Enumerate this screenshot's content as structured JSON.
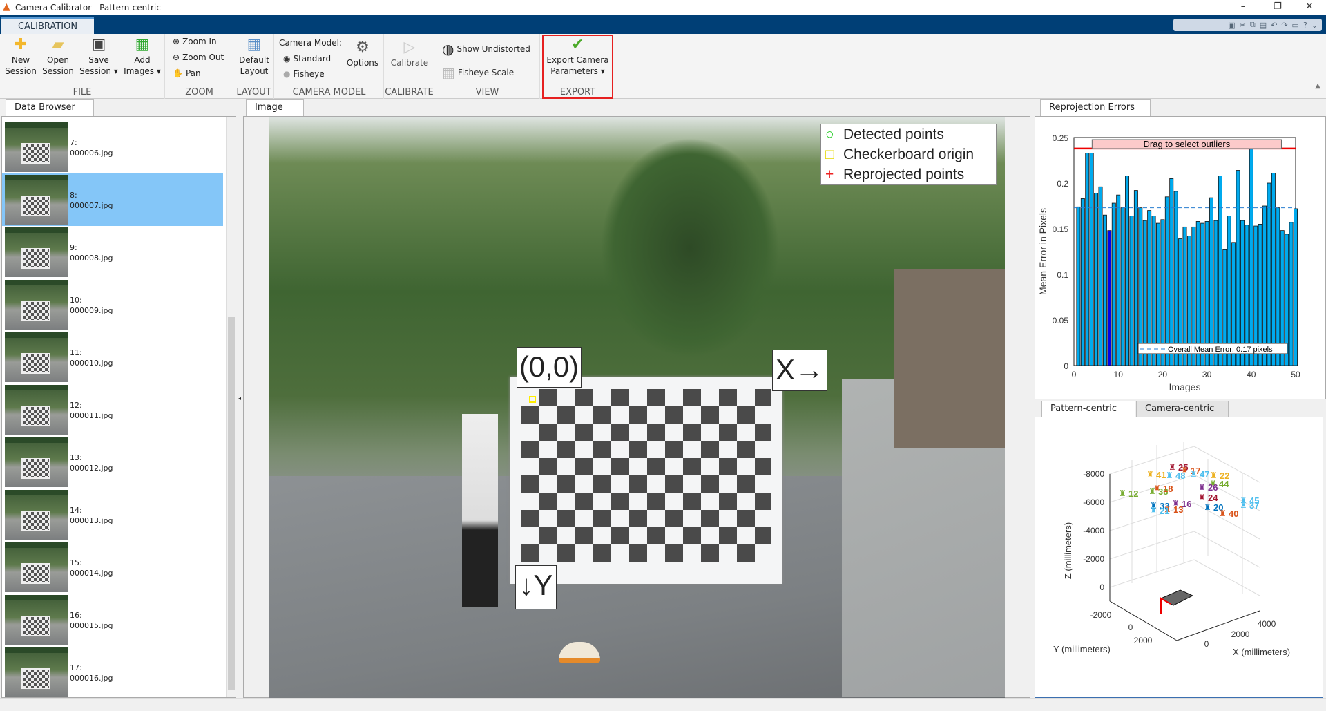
{
  "window": {
    "title": "Camera Calibrator - Pattern-centric",
    "controls": [
      "minimize",
      "restore",
      "close"
    ]
  },
  "ribbon": {
    "tab": "CALIBRATION",
    "groups": {
      "file": {
        "label": "FILE",
        "new_session": "New Session",
        "open_session": "Open Session",
        "save_session": "Save Session",
        "add_images": "Add Images"
      },
      "zoom": {
        "label": "ZOOM",
        "zoom_in": "Zoom In",
        "zoom_out": "Zoom Out",
        "pan": "Pan"
      },
      "layout": {
        "label": "LAYOUT",
        "default_layout": "Default Layout"
      },
      "camera_model": {
        "label": "CAMERA MODEL",
        "title": "Camera Model:",
        "standard": "Standard",
        "fisheye": "Fisheye",
        "selected": "Standard",
        "options": "Options"
      },
      "calibrate": {
        "label": "CALIBRATE",
        "calibrate": "Calibrate"
      },
      "view": {
        "label": "VIEW",
        "show_undistorted": "Show Undistorted",
        "fisheye_scale": "Fisheye Scale"
      },
      "export": {
        "label": "EXPORT",
        "export_camera_parameters": "Export Camera Parameters",
        "highlight_color": "#e62020"
      }
    }
  },
  "data_browser": {
    "tab": "Data Browser",
    "selected_index": 1,
    "items": [
      {
        "num": "7:",
        "file": "000006.jpg"
      },
      {
        "num": "8:",
        "file": "000007.jpg"
      },
      {
        "num": "9:",
        "file": "000008.jpg"
      },
      {
        "num": "10:",
        "file": "000009.jpg"
      },
      {
        "num": "11:",
        "file": "000010.jpg"
      },
      {
        "num": "12:",
        "file": "000011.jpg"
      },
      {
        "num": "13:",
        "file": "000012.jpg"
      },
      {
        "num": "14:",
        "file": "000013.jpg"
      },
      {
        "num": "15:",
        "file": "000014.jpg"
      },
      {
        "num": "16:",
        "file": "000015.jpg"
      },
      {
        "num": "17:",
        "file": "000016.jpg"
      }
    ],
    "selected_color": "#84c6f8"
  },
  "image_panel": {
    "tab": "Image",
    "legend": {
      "detected": "Detected points",
      "origin": "Checkerboard origin",
      "reprojected": "Reprojected points"
    },
    "origin_label": "(0,0)",
    "x_label": "X→",
    "y_label": "↓Y"
  },
  "reprojection": {
    "tab": "Reprojection Errors",
    "drag_label": "Drag to select outliers",
    "chart_data": {
      "type": "bar",
      "xlabel": "Images",
      "ylabel": "Mean Error in Pixels",
      "xlim": [
        0,
        50
      ],
      "ylim": [
        0,
        0.25
      ],
      "xticks": [
        0,
        10,
        20,
        30,
        40,
        50
      ],
      "yticks": [
        0,
        0.05,
        0.1,
        0.15,
        0.2,
        0.25
      ],
      "x": [
        1,
        2,
        3,
        4,
        5,
        6,
        7,
        8,
        9,
        10,
        11,
        12,
        13,
        14,
        15,
        16,
        17,
        18,
        19,
        20,
        21,
        22,
        23,
        24,
        25,
        26,
        27,
        28,
        29,
        30,
        31,
        32,
        33,
        34,
        35,
        36,
        37,
        38,
        39,
        40,
        41,
        42,
        43,
        44,
        45,
        46,
        47,
        48,
        49,
        50
      ],
      "values": [
        0.174,
        0.183,
        0.233,
        0.233,
        0.189,
        0.196,
        0.165,
        0.148,
        0.178,
        0.187,
        0.173,
        0.208,
        0.164,
        0.192,
        0.173,
        0.159,
        0.17,
        0.164,
        0.156,
        0.16,
        0.185,
        0.205,
        0.191,
        0.139,
        0.152,
        0.142,
        0.152,
        0.158,
        0.156,
        0.158,
        0.184,
        0.159,
        0.208,
        0.127,
        0.164,
        0.135,
        0.214,
        0.159,
        0.154,
        0.239,
        0.153,
        0.155,
        0.175,
        0.2,
        0.211,
        0.173,
        0.148,
        0.144,
        0.157,
        0.172
      ],
      "selected_image": 8,
      "overall_mean": 0.173,
      "outlier_threshold": 0.238,
      "legend": "Overall Mean Error: 0.17 pixels",
      "legend_position": "bottom-right",
      "bar_color": "#00aaee",
      "selected_color": "#0000ee",
      "threshold_color": "#ee0000"
    }
  },
  "extrinsics": {
    "tabs": [
      "Pattern-centric",
      "Camera-centric"
    ],
    "active_tab": "Pattern-centric",
    "chart_data": {
      "type": "scatter3d",
      "xlabel": "X (millimeters)",
      "ylabel": "Y (millimeters)",
      "zlabel": "Z (millimeters)",
      "xticks": [
        "0",
        "2000",
        "4000"
      ],
      "yticks": [
        "-2000",
        "0",
        "2000"
      ],
      "zticks": [
        "-8000",
        "-6000",
        "-4000",
        "-2000",
        "0"
      ],
      "camera_labels": [
        {
          "t": "12",
          "c": "#77ac30"
        },
        {
          "t": "41",
          "c": "#edb120"
        },
        {
          "t": "48",
          "c": "#4dbeee"
        },
        {
          "t": "25",
          "c": "#a2142f"
        },
        {
          "t": "17",
          "c": "#d95319"
        },
        {
          "t": "47",
          "c": "#4dbeee"
        },
        {
          "t": "22",
          "c": "#edb120"
        },
        {
          "t": "44",
          "c": "#77ac30"
        },
        {
          "t": "26",
          "c": "#7e2f8e"
        },
        {
          "t": "38",
          "c": "#77ac30"
        },
        {
          "t": "18",
          "c": "#d95319"
        },
        {
          "t": "24",
          "c": "#a2142f"
        },
        {
          "t": "33",
          "c": "#0072bd"
        },
        {
          "t": "16",
          "c": "#7e2f8e"
        },
        {
          "t": "13",
          "c": "#d95319"
        },
        {
          "t": "21",
          "c": "#4dbeee"
        },
        {
          "t": "20",
          "c": "#0072bd"
        },
        {
          "t": "45",
          "c": "#4dbeee"
        },
        {
          "t": "37",
          "c": "#4dbeee"
        },
        {
          "t": "40",
          "c": "#d95319"
        }
      ]
    }
  }
}
